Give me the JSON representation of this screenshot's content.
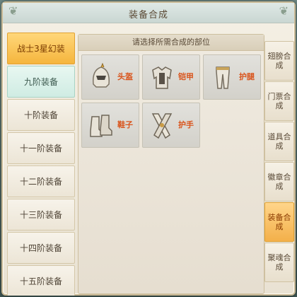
{
  "window": {
    "title": "装备合成"
  },
  "left_list": {
    "items": [
      {
        "label": "战士3星幻装",
        "state": "active"
      },
      {
        "label": "九阶装备",
        "state": "selected"
      },
      {
        "label": "十阶装备",
        "state": "normal"
      },
      {
        "label": "十一阶装备",
        "state": "normal"
      },
      {
        "label": "十二阶装备",
        "state": "normal"
      },
      {
        "label": "十三阶装备",
        "state": "normal"
      },
      {
        "label": "十四阶装备",
        "state": "normal"
      },
      {
        "label": "十五阶装备",
        "state": "normal"
      }
    ]
  },
  "main": {
    "header": "请选择所需合成的部位",
    "slots": [
      {
        "label": "头盔",
        "icon": "helmet-icon"
      },
      {
        "label": "铠甲",
        "icon": "armor-icon"
      },
      {
        "label": "护腿",
        "icon": "leggings-icon"
      },
      {
        "label": "鞋子",
        "icon": "boots-icon"
      },
      {
        "label": "护手",
        "icon": "gauntlets-icon"
      }
    ]
  },
  "right_tabs": [
    {
      "label": "翅膀合成"
    },
    {
      "label": "门票合成"
    },
    {
      "label": "道具合成"
    },
    {
      "label": "徽章合成"
    },
    {
      "label": "装备合成",
      "active": true
    },
    {
      "label": "聚魂合成"
    }
  ],
  "colors": {
    "accent": "#f5b53d",
    "slot_label": "#d9541c"
  }
}
